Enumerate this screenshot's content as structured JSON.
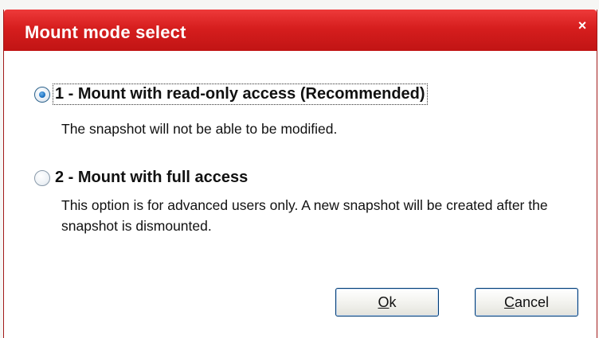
{
  "window": {
    "title": "Mount mode select",
    "close_glyph": "×",
    "title_color": "#d61e1e"
  },
  "options": [
    {
      "label": "1 - Mount with read-only access (Recommended)",
      "description": "The snapshot will not be able to be modified.",
      "selected": true
    },
    {
      "label": "2 - Mount with full access",
      "description": "This option is for advanced users only. A new snapshot will be created after the snapshot is dismounted.",
      "selected": false
    }
  ],
  "buttons": {
    "ok_label": "Ok",
    "cancel_label": "Cancel"
  },
  "icons": {
    "close": "close-icon",
    "radio_selected": "radio-selected-icon",
    "radio_unselected": "radio-unselected-icon"
  }
}
